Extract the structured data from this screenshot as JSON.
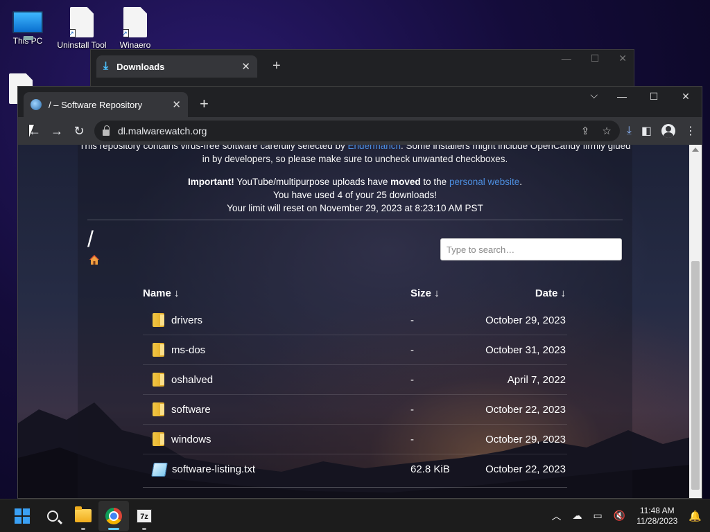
{
  "desktop": {
    "icons": [
      {
        "label": "This PC"
      },
      {
        "label": "Uninstall Tool"
      },
      {
        "label": "Winaero"
      }
    ]
  },
  "downloads_window": {
    "tab_title": "Downloads",
    "close_glyph": "✕",
    "new_tab_glyph": "+"
  },
  "browser": {
    "tab_title": "/ – Software Repository",
    "close_glyph": "✕",
    "new_tab_glyph": "+",
    "url": "dl.malwarewatch.org",
    "window_controls": {
      "minimize": "—",
      "maximize": "☐",
      "close": "✕",
      "tab_search": "⌵"
    }
  },
  "page": {
    "intro_line1_a": "This repository contains virus-free software carefully selected by ",
    "intro_link": "Endermanch",
    "intro_line1_b": ". Some installers might include OpenCandy firmly glued",
    "intro_line2": "in by developers, so please make sure to uncheck unwanted checkboxes.",
    "important_label": "Important!",
    "important_text_a": " YouTube/multipurpose uploads have ",
    "important_moved": "moved",
    "important_text_b": " to the ",
    "important_link": "personal website",
    "important_text_c": ".",
    "downloads_used": "You have used 4 of your 25 downloads!",
    "limit_reset": "Your limit will reset on November 29, 2023 at 8:23:10 AM PST",
    "path": "/",
    "search_placeholder": "Type to search…",
    "columns": {
      "name": "Name",
      "size": "Size",
      "date": "Date",
      "sort_glyph": "↓"
    },
    "entries": [
      {
        "name": "drivers",
        "size": "-",
        "date": "October 29, 2023",
        "type": "folder"
      },
      {
        "name": "ms-dos",
        "size": "-",
        "date": "October 31, 2023",
        "type": "folder"
      },
      {
        "name": "oshalved",
        "size": "-",
        "date": "April 7, 2022",
        "type": "folder"
      },
      {
        "name": "software",
        "size": "-",
        "date": "October 22, 2023",
        "type": "folder"
      },
      {
        "name": "windows",
        "size": "-",
        "date": "October 29, 2023",
        "type": "folder"
      },
      {
        "name": "software-listing.txt",
        "size": "62.8 KiB",
        "date": "October 22, 2023",
        "type": "file"
      }
    ]
  },
  "taskbar": {
    "time": "11:48 AM",
    "date": "11/28/2023",
    "sevenzip_label": "7z"
  },
  "colors": {
    "accent": "#60cdff",
    "link": "#4d8fe0",
    "chrome_dark": "#202124",
    "chrome_toolbar": "#35363a"
  }
}
